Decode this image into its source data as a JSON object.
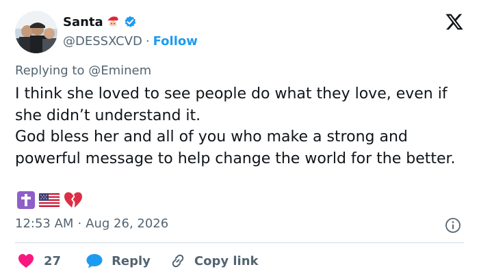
{
  "author": {
    "display_name": "Santa",
    "handle": "@DESSXCVD",
    "separator": "·",
    "follow_label": "Follow"
  },
  "reply_context": {
    "prefix": "Replying to",
    "mention": "@Eminem"
  },
  "tweet": {
    "lines": [
      "I think she loved to see people do what they love, even if she didn’t understand it.",
      "God bless her and all of you who make a strong and powerful message to help change the world for the better."
    ],
    "emojis": [
      "cross-emoji",
      "us-flag-emoji",
      "broken-heart-emoji"
    ]
  },
  "meta": {
    "time": "12:53 AM",
    "separator": "·",
    "date": "Aug 26, 2026"
  },
  "actions": {
    "like_count": "27",
    "reply_label": "Reply",
    "copy_link_label": "Copy link"
  },
  "colors": {
    "text": "#0f1419",
    "secondary": "#536471",
    "accent": "#1d9bf0",
    "like": "#f91880",
    "divider": "#cfd9de"
  }
}
